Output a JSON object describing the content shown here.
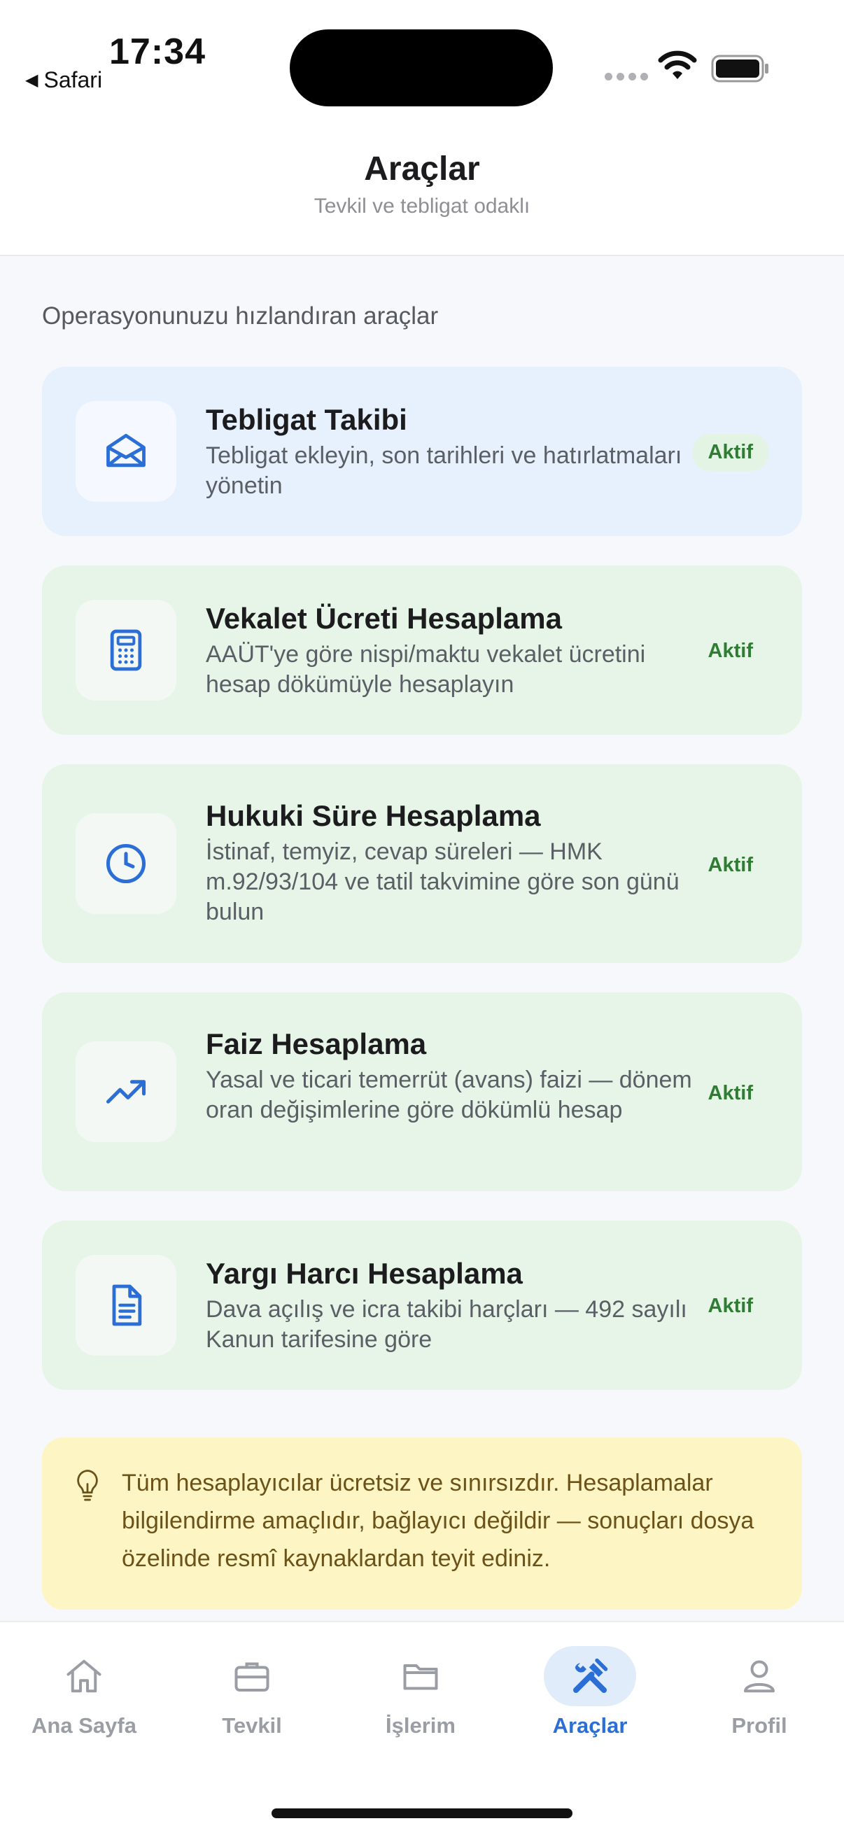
{
  "status": {
    "time": "17:34",
    "back_app": "Safari"
  },
  "header": {
    "title": "Araçlar",
    "subtitle": "Tevkil ve tebligat odaklı"
  },
  "section_title": "Operasyonunuzu hızlandıran araçlar",
  "tools": [
    {
      "title": "Tebligat Takibi",
      "desc": "Tebligat ekleyin, son tarihleri ve hatırlatmaları yönetin",
      "badge": "Aktif",
      "icon": "envelope-icon"
    },
    {
      "title": "Vekalet Ücreti Hesaplama",
      "desc": "AAÜT'ye göre nispi/maktu vekalet ücretini hesap dökümüyle hesaplayın",
      "badge": "Aktif",
      "icon": "calculator-icon"
    },
    {
      "title": "Hukuki Süre Hesaplama",
      "desc": "İstinaf, temyiz, cevap süreleri — HMK m.92/93/104 ve tatil takvimine göre son günü bulun",
      "badge": "Aktif",
      "icon": "clock-icon"
    },
    {
      "title": "Faiz Hesaplama",
      "desc": "Yasal ve ticari temerrüt (avans) faizi — dönem oran değişimlerine göre dökümlü hesap",
      "badge": "Aktif",
      "icon": "trend-up-icon"
    },
    {
      "title": "Yargı Harcı Hesaplama",
      "desc": "Dava açılış ve icra takibi harçları — 492 sayılı Kanun tarifesine göre",
      "badge": "Aktif",
      "icon": "document-icon"
    }
  ],
  "info_text": "Tüm hesaplayıcılar ücretsiz ve sınırsızdır. Hesaplamalar bilgilendirme amaçlıdır, bağlayıcı değildir — sonuçları dosya özelinde resmî kaynaklardan teyit ediniz.",
  "tabs": [
    {
      "label": "Ana Sayfa",
      "icon": "home-icon"
    },
    {
      "label": "Tevkil",
      "icon": "briefcase-icon"
    },
    {
      "label": "İşlerim",
      "icon": "folder-icon"
    },
    {
      "label": "Araçlar",
      "icon": "tools-icon",
      "active": true
    },
    {
      "label": "Profil",
      "icon": "person-icon"
    }
  ],
  "colors": {
    "accent_blue": "#2b6fd6",
    "active_green": "#2e7d32",
    "card_green": "#e7f5e8",
    "card_blue": "#e7f0fd",
    "info_yellow": "#fdf6c4"
  }
}
